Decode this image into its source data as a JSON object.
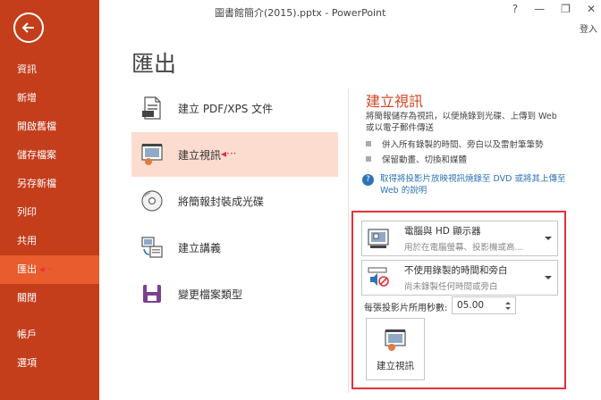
{
  "window": {
    "title": "圖書館簡介(2015).pptx - PowerPoint",
    "help": "?",
    "minimize": "—",
    "restore": "❐",
    "close": "✕",
    "login": "登入"
  },
  "sidebar": {
    "items": [
      {
        "label": "資訊"
      },
      {
        "label": "新增"
      },
      {
        "label": "開啟舊檔"
      },
      {
        "label": "儲存檔案"
      },
      {
        "label": "另存新檔"
      },
      {
        "label": "列印"
      },
      {
        "label": "共用"
      },
      {
        "label": "匯出",
        "active": true
      },
      {
        "label": "關閉"
      },
      {
        "label": "帳戶"
      },
      {
        "label": "選項"
      }
    ],
    "arrow": "◂···"
  },
  "page": {
    "title": "匯出"
  },
  "options": [
    {
      "label": "建立 PDF/XPS 文件",
      "icon": "pdf-xps-icon"
    },
    {
      "label": "建立視訊",
      "icon": "video-icon",
      "active": true
    },
    {
      "label": "將簡報封裝成光碟",
      "icon": "cd-icon"
    },
    {
      "label": "建立講義",
      "icon": "handout-icon"
    },
    {
      "label": "變更檔案類型",
      "icon": "file-type-icon"
    }
  ],
  "option_arrow": "◂···",
  "panel": {
    "title": "建立視訊",
    "description": "將簡報儲存為視訊，以便燒錄到光碟、上傳到 Web 或以電子郵件傳送",
    "bullets": [
      "併入所有錄製的時間、旁白以及雷射筆筆勢",
      "保留動畫、切換和媒體"
    ],
    "help_icon": "?",
    "help_link": "取得將投影片放映視訊燒錄至 DVD 或將其上傳至 Web 的說明",
    "quality": {
      "main": "電腦與 HD 顯示器",
      "sub": "用於在電腦螢幕、投影機或高..."
    },
    "timings": {
      "main": "不使用錄製的時間和旁白",
      "sub": "尚未錄製任何時間或旁白"
    },
    "seconds_label": "每張投影片所用秒數:",
    "seconds_value": "05.00",
    "create_button": "建立視訊"
  },
  "colors": {
    "sidebar": "#c43e1c",
    "sidebar_active": "#e85c2d",
    "accent": "#d24726",
    "selected_option": "#fcdcce",
    "annotation": "#e8303a"
  }
}
